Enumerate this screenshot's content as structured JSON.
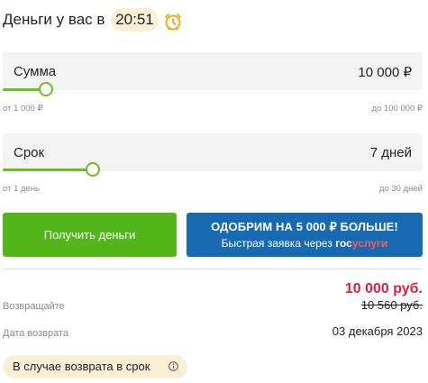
{
  "header": {
    "label": "Деньги у вас в",
    "time": "20:51",
    "alarm_icon": "alarm-clock-icon",
    "alarm_color": "#f0a500"
  },
  "amount": {
    "label": "Сумма",
    "value": "10 000 ₽",
    "min_hint": "от 1 000 ₽",
    "max_hint": "до 100 000 ₽",
    "position_fraction": 0.1
  },
  "term": {
    "label": "Срок",
    "value": "7 дней",
    "min_hint": "от 1 день",
    "max_hint": "до 30 дней",
    "position_fraction": 0.21
  },
  "buttons": {
    "get_money": "Получить деньги",
    "promo_line1": "ОДОБРИМ НА 5 000 ₽ БОЛЬШЕ!",
    "promo_line2_prefix": "Быстрая заявка через ",
    "promo_gos": "гос",
    "promo_uslugi": "услуги"
  },
  "return": {
    "label": "Возвращайте",
    "new_amount": "10 000 руб.",
    "old_amount": "10 560 руб.",
    "date_label": "Дата возврата",
    "date_value": "03 декабря 2023"
  },
  "info": {
    "label": "В случае возврата в срок",
    "icon": "info-icon"
  },
  "colors": {
    "accent_green": "#52b51a",
    "slider_green": "#6bbf1f",
    "promo_blue": "#1769b2",
    "price_red": "#e01e3c",
    "pill_bg": "#faf0d6"
  }
}
